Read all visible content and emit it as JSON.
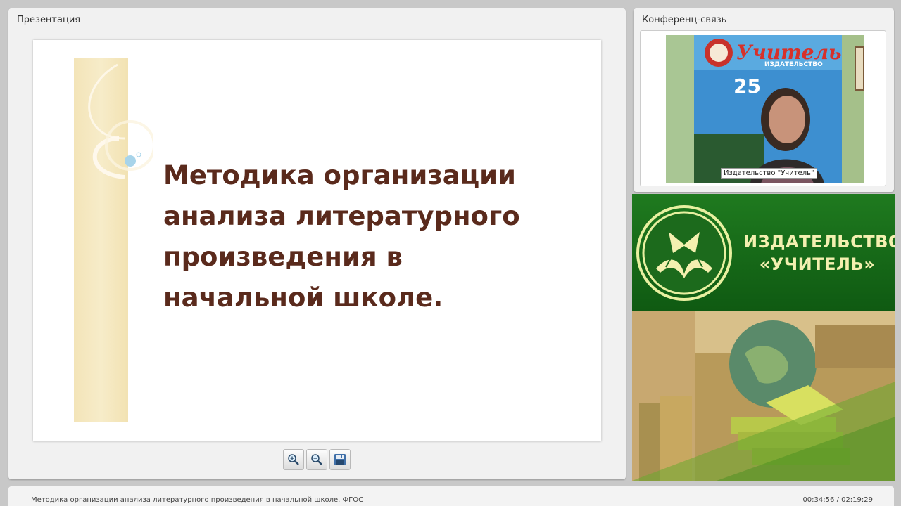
{
  "presentation": {
    "title": "Презентация",
    "slide_title": "Методика организации анализа литературного произведения в начальной школе.",
    "toolbar": [
      {
        "name": "zoom-in",
        "icon": "zoom-in-icon"
      },
      {
        "name": "zoom-out",
        "icon": "zoom-out-icon"
      },
      {
        "name": "save",
        "icon": "save-icon"
      }
    ]
  },
  "conference": {
    "title": "Конференц-связь",
    "participant_label": "Издательство \"Учитель\"",
    "poster_title": "Учитель",
    "poster_subtitle": "ИЗДАТЕЛЬСТВО",
    "poster_number": "25"
  },
  "banner": {
    "line1": "ИЗДАТЕЛЬСТВО",
    "line2": "«УЧИТЕЛЬ»",
    "brand_color": "#1f7a1f"
  },
  "footer": {
    "title": "Методика организации анализа литературного произведения в начальной школе. ФГОС",
    "time": "00:34:56 / 02:19:29"
  }
}
